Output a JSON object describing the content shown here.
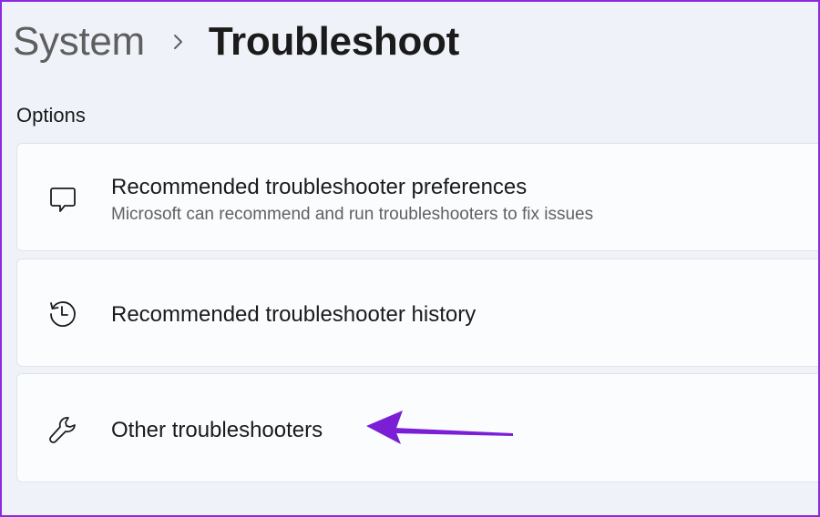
{
  "breadcrumb": {
    "parent": "System",
    "separator_icon": "chevron-right-icon",
    "current": "Troubleshoot"
  },
  "section": {
    "title": "Options"
  },
  "options": [
    {
      "icon": "feedback-bubble-icon",
      "title": "Recommended troubleshooter preferences",
      "description": "Microsoft can recommend and run troubleshooters to fix issues"
    },
    {
      "icon": "history-icon",
      "title": "Recommended troubleshooter history"
    },
    {
      "icon": "wrench-icon",
      "title": "Other troubleshooters"
    }
  ],
  "annotation": {
    "arrow_color": "#7a1fd6",
    "points_to": "Other troubleshooters"
  },
  "colors": {
    "background": "#eff3f9",
    "card": "#fbfcfe",
    "frame_border": "#8a2be2"
  }
}
